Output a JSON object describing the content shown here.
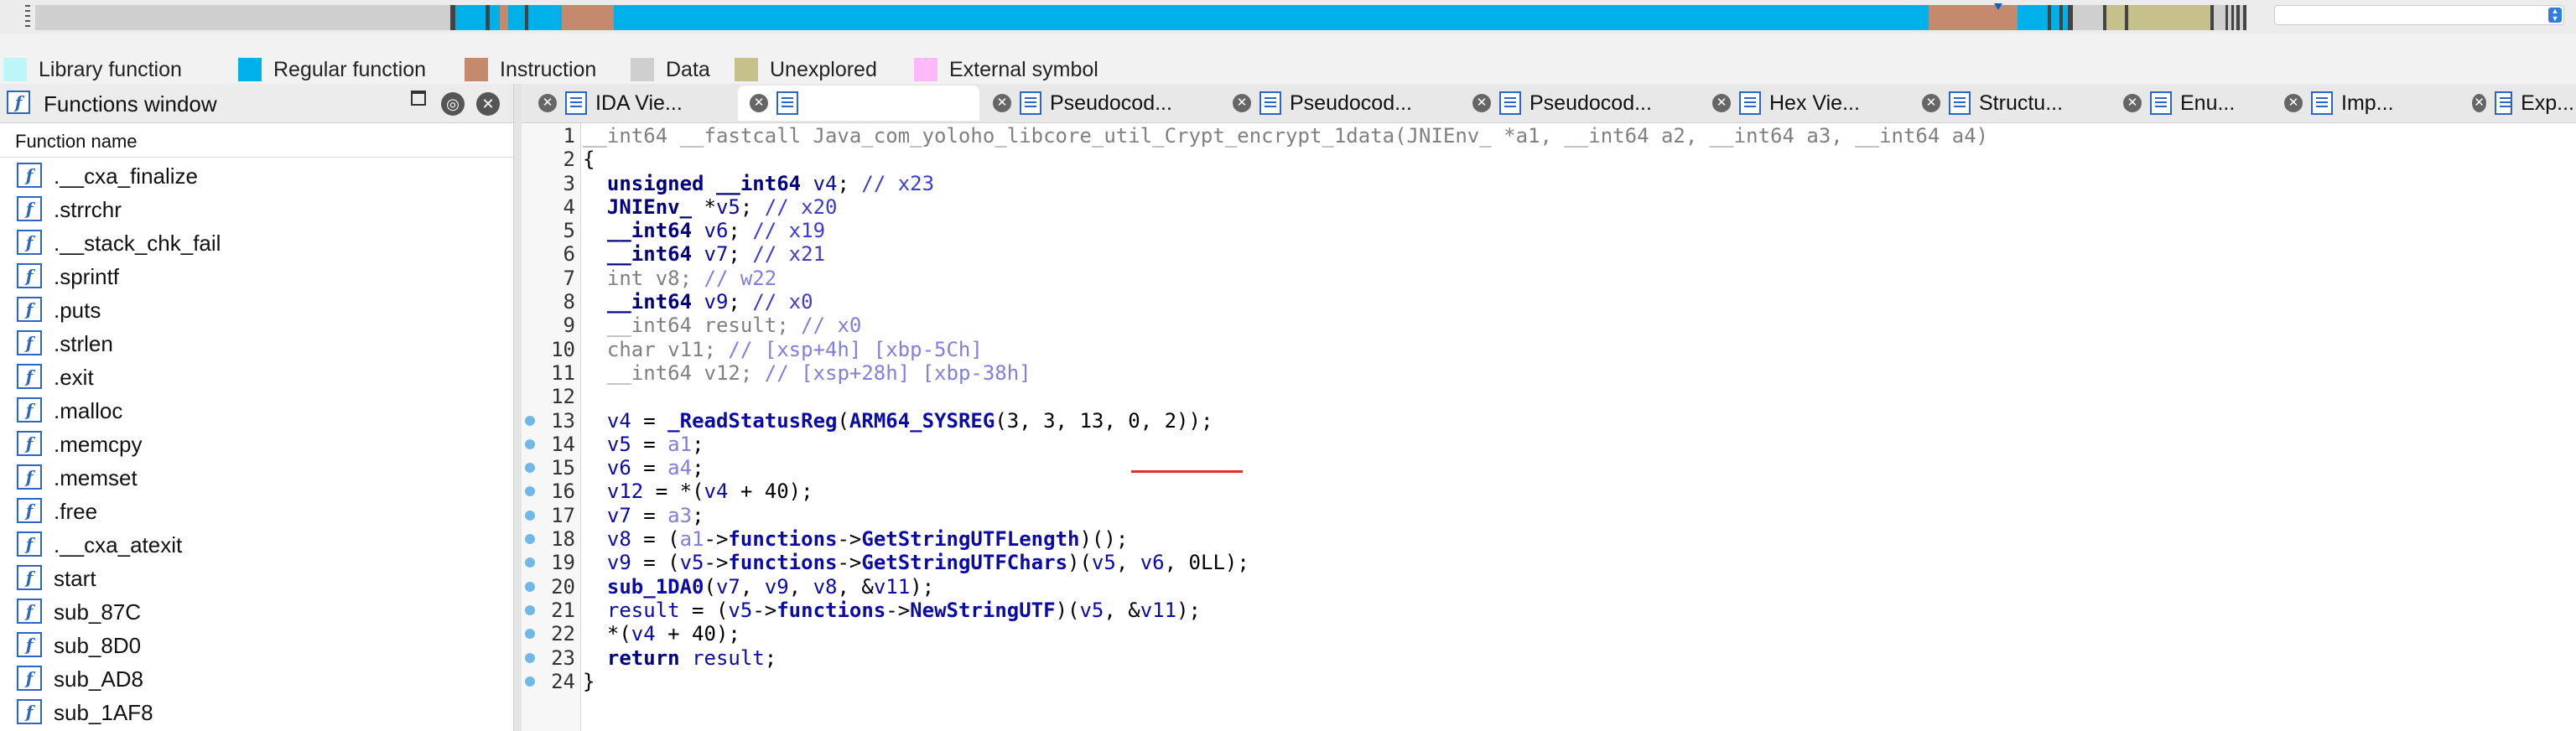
{
  "colors": {
    "library_function": "#bdf6f8",
    "regular_function": "#00b0e8",
    "instruction": "#c58a6e",
    "data": "#cfcfcf",
    "unexplored": "#c6c18a",
    "external_symbol": "#ffb8f8",
    "accent": "#2a66c2",
    "highlight_underline": "#e0302a"
  },
  "legend": {
    "items": [
      {
        "label": "Library function",
        "color": "#bdf6f8"
      },
      {
        "label": "Regular function",
        "color": "#00b0e8"
      },
      {
        "label": "Instruction",
        "color": "#c58a6e"
      },
      {
        "label": "Data",
        "color": "#cfcfcf"
      },
      {
        "label": "Unexplored",
        "color": "#c6c18a"
      },
      {
        "label": "External symbol",
        "color": "#ffb8f8"
      }
    ]
  },
  "functions_window": {
    "title": "Functions window",
    "column_header": "Function name",
    "icon": "function-icon",
    "items": [
      ".__cxa_finalize",
      ".strrchr",
      ".__stack_chk_fail",
      ".sprintf",
      ".puts",
      ".strlen",
      ".exit",
      ".malloc",
      ".memcpy",
      ".memset",
      ".free",
      ".__cxa_atexit",
      "start",
      "sub_87C",
      "sub_8D0",
      "sub_AD8",
      "sub_1AF8"
    ]
  },
  "tabs": [
    {
      "label": "IDA Vie...",
      "icon": "ida-view-icon"
    },
    {
      "label": "",
      "icon": "pseudocode-icon",
      "active": true
    },
    {
      "label": "Pseudocod...",
      "icon": "pseudocode-icon"
    },
    {
      "label": "Pseudocod...",
      "icon": "pseudocode-icon"
    },
    {
      "label": "Pseudocod...",
      "icon": "pseudocode-icon"
    },
    {
      "label": "Hex Vie...",
      "icon": "hex-view-icon"
    },
    {
      "label": "Structu...",
      "icon": "structures-icon"
    },
    {
      "label": "Enu...",
      "icon": "enums-icon"
    },
    {
      "label": "Imp...",
      "icon": "imports-icon"
    },
    {
      "label": "Exp...",
      "icon": "exports-icon"
    }
  ],
  "code": {
    "lines": [
      {
        "n": "1",
        "text": "__int64 __fastcall Java_com_yoloho_libcore_util_Crypt_encrypt_1data(JNIEnv_ *a1, __int64 a2, __int64 a3, __int64 a4)",
        "bp": false
      },
      {
        "n": "2",
        "text": "{",
        "bp": false
      },
      {
        "n": "3",
        "text": "  unsigned __int64 v4; // x23",
        "bp": false
      },
      {
        "n": "4",
        "text": "  JNIEnv_ *v5; // x20",
        "bp": false
      },
      {
        "n": "5",
        "text": "  __int64 v6; // x19",
        "bp": false
      },
      {
        "n": "6",
        "text": "  __int64 v7; // x21",
        "bp": false
      },
      {
        "n": "7",
        "text": "  int v8; // w22",
        "bp": false
      },
      {
        "n": "8",
        "text": "  __int64 v9; // x0",
        "bp": false
      },
      {
        "n": "9",
        "text": "  __int64 result; // x0",
        "bp": false
      },
      {
        "n": "10",
        "text": "  char v11; // [xsp+4h] [xbp-5Ch]",
        "bp": false
      },
      {
        "n": "11",
        "text": "  __int64 v12; // [xsp+28h] [xbp-38h]",
        "bp": false
      },
      {
        "n": "12",
        "text": "",
        "bp": false
      },
      {
        "n": "13",
        "text": "  v4 = _ReadStatusReg(ARM64_SYSREG(3, 3, 13, 0, 2));",
        "bp": true
      },
      {
        "n": "14",
        "text": "  v5 = a1;",
        "bp": true
      },
      {
        "n": "15",
        "text": "  v6 = a4;",
        "bp": true
      },
      {
        "n": "16",
        "text": "  v12 = *(v4 + 40);",
        "bp": true
      },
      {
        "n": "17",
        "text": "  v7 = a3;",
        "bp": true
      },
      {
        "n": "18",
        "text": "  v8 = (a1->functions->GetStringUTFLength)();",
        "bp": true
      },
      {
        "n": "19",
        "text": "  v9 = (v5->functions->GetStringUTFChars)(v5, v6, 0LL);",
        "bp": true
      },
      {
        "n": "20",
        "text": "  sub_1DA0(v7, v9, v8, &v11);",
        "bp": true
      },
      {
        "n": "21",
        "text": "  result = (v5->functions->NewStringUTF)(v5, &v11);",
        "bp": true
      },
      {
        "n": "22",
        "text": "  *(v4 + 40);",
        "bp": true
      },
      {
        "n": "23",
        "text": "  return result;",
        "bp": true
      },
      {
        "n": "24",
        "text": "}",
        "bp": true
      }
    ]
  }
}
